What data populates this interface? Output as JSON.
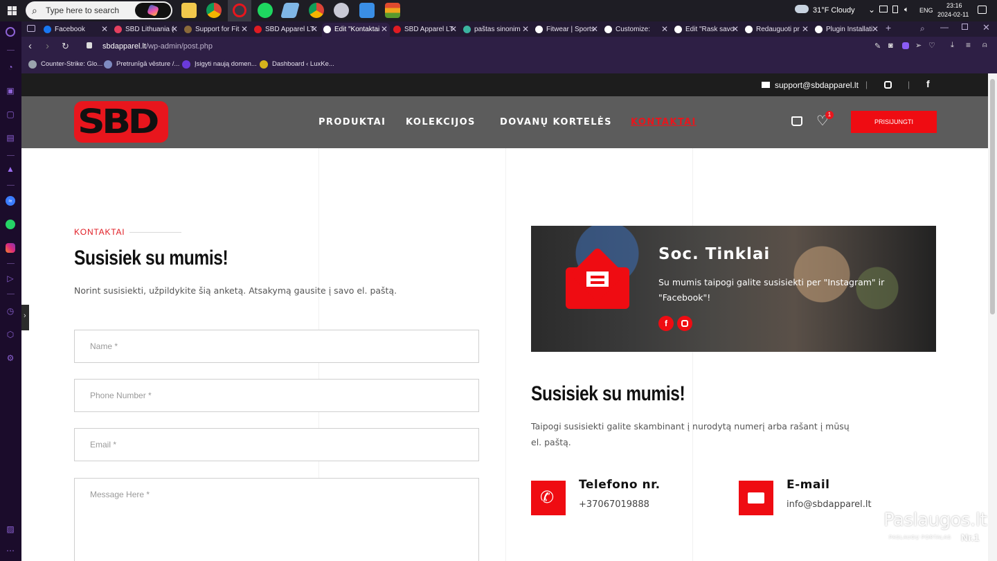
{
  "taskbar": {
    "search_placeholder": "Type here to search",
    "weather": "31°F  Cloudy",
    "language": "ENG",
    "time": "23:16",
    "date": "2024-02-11"
  },
  "tabs": [
    {
      "label": "Facebook",
      "color": "#1877f2"
    },
    {
      "label": "SBD Lithuania (",
      "color": "#e4405f"
    },
    {
      "label": "Support for Fit",
      "color": "#8a6a3a"
    },
    {
      "label": "SBD Apparel LT",
      "color": "#e01b22"
    },
    {
      "label": "Edit \"Kontaktai",
      "color": "#ffffff",
      "active": true
    },
    {
      "label": "SBD Apparel LT",
      "color": "#e01b22"
    },
    {
      "label": "paštas sinonim",
      "color": "#3bb3a0"
    },
    {
      "label": "Fitwear | Sports",
      "color": "#ffffff"
    },
    {
      "label": "Customize:",
      "color": "#ffffff"
    },
    {
      "label": "Edit \"Rask savo",
      "color": "#ffffff"
    },
    {
      "label": "Redauguoti pr",
      "color": "#ffffff"
    },
    {
      "label": "Plugin Installati",
      "color": "#ffffff"
    }
  ],
  "address": {
    "domain": "sbdapparel.lt",
    "path": "/wp-admin/post.php"
  },
  "bookmarks": [
    {
      "label": "Counter-Strike: Glo...",
      "color": "#9aa3ad"
    },
    {
      "label": "Pretrunīgā vēsture /...",
      "color": "#7e8ac0"
    },
    {
      "label": "Įsigyti naują domen...",
      "color": "#6a3ad9"
    },
    {
      "label": "Dashboard ‹ LuxKe...",
      "color": "#d6b21c"
    }
  ],
  "site": {
    "support_email": "support@sbdapparel.lt",
    "logo_text": "SBD",
    "nav": [
      "PRODUKTAI",
      "KOLEKCIJOS",
      "DOVANŲ KORTELĖS",
      "KONTAKTAI"
    ],
    "wishlist_count": "1",
    "login_label": "PRISIJUNGTI"
  },
  "form": {
    "eyebrow": "KONTAKTAI",
    "heading": "Susisiek su mumis!",
    "subtitle": "Norint susisiekti, užpildykite šią anketą. Atsakymą gausite į savo el. paštą.",
    "name_placeholder": "Name *",
    "phone_placeholder": "Phone Number *",
    "email_placeholder": "Email *",
    "message_placeholder": "Message Here *"
  },
  "social_card": {
    "title": "Soc. Tinklai",
    "text_line1": "Su mumis taipogi galite susisiekti per \"Instagram\" ir",
    "text_line2": "\"Facebook\"!"
  },
  "contact_info": {
    "heading": "Susisiek su mumis!",
    "text_line1": "Taipogi susisiekti galite skambinant į nurodytą numerį arba rašant į mūsų",
    "text_line2": "el. paštą.",
    "phone_title": "Telefono nr.",
    "phone_value": "+37067019888",
    "email_title": "E-mail",
    "email_value": "info@sbdapparel.lt"
  },
  "watermark": {
    "brand": "Paslaugos.lt",
    "tagline": "PASLAUGŲ PORTALAS",
    "rank": "Nr.1"
  },
  "colors": {
    "accent_red": "#ef0c12",
    "header_gray": "#5c5c5c",
    "opera_purple": "#2e1f45"
  }
}
